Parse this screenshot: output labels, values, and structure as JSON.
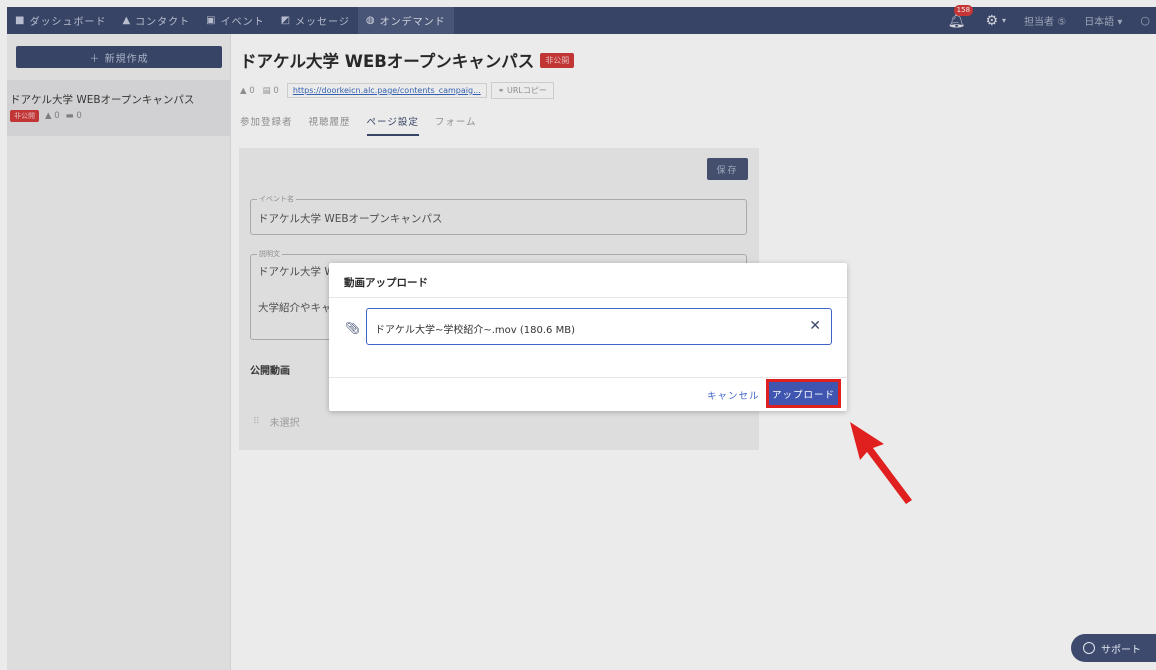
{
  "nav": {
    "items": [
      {
        "icon": "grid",
        "label": "ダッシュボード"
      },
      {
        "icon": "person",
        "label": "コンタクト"
      },
      {
        "icon": "calendar",
        "label": "イベント"
      },
      {
        "icon": "message",
        "label": "メッセージ"
      },
      {
        "icon": "globe",
        "label": "オンデマンド"
      }
    ],
    "notification_count": "158",
    "assignee_label": "担当者 ⑤",
    "language_label": "日本語 ▾"
  },
  "sidebar": {
    "new_button_label": "＋ 新規作成",
    "card": {
      "title": "ドアケル大学 WEBオープンキャンパス",
      "status_badge": "非公開",
      "participants_count": "0",
      "views_count": "0"
    }
  },
  "page": {
    "title": "ドアケル大学 WEBオープンキャンパス",
    "status_badge": "非公開",
    "participants_count": "0",
    "files_count": "0",
    "url": "https://doorkeicn.alc.page/contents_campaig...",
    "copy_url_label": "URLコピー",
    "tabs": [
      "参加登録者",
      "視聴履歴",
      "ページ設定",
      "フォーム"
    ],
    "active_tab_index": 2
  },
  "form": {
    "save_label": "保存",
    "event_name_label": "イベント名",
    "event_name_value": "ドアケル大学 WEBオープンキャンパス",
    "description_label": "説明文",
    "description_line1": "ドアケル大学 W",
    "description_line2": "大学紹介やキャ",
    "public_video_label": "公開動画",
    "unselected_label": "未選択"
  },
  "modal": {
    "title": "動画アップロード",
    "file_value": "ドアケル大学~学校紹介~.mov (180.6 MB)",
    "cancel_label": "キャンセル",
    "upload_label": "アップロード"
  },
  "support_label": "サポート",
  "colors": {
    "nav_bg": "#3d4a6e",
    "accent": "#3f55b0",
    "highlight_red": "#e0201e",
    "badge_red": "#d33a3a"
  }
}
